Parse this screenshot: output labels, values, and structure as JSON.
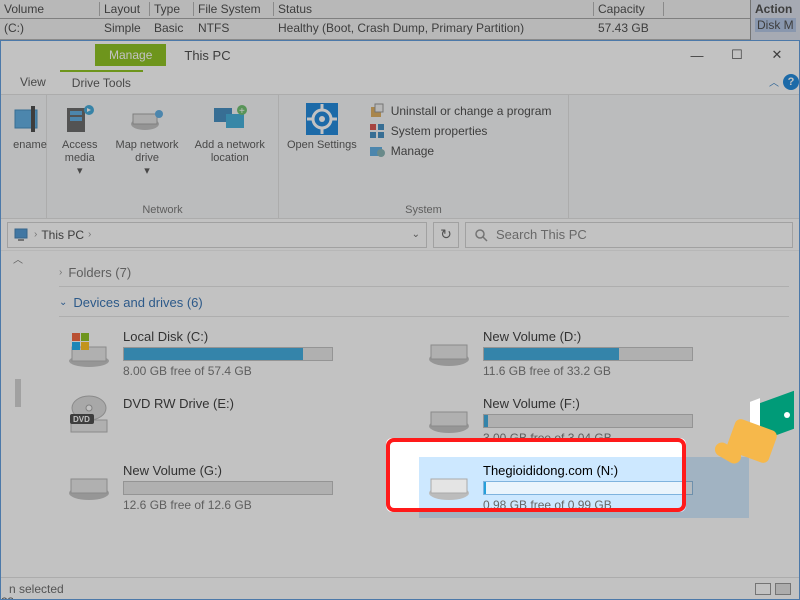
{
  "bg": {
    "headers": {
      "volume": "Volume",
      "layout": "Layout",
      "type": "Type",
      "fs": "File System",
      "status": "Status",
      "capacity": "Capacity"
    },
    "row": {
      "volume": "(C:)",
      "layout": "Simple",
      "type": "Basic",
      "fs": "NTFS",
      "status": "Healthy (Boot, Crash Dump, Primary Partition)",
      "capacity": "57.43 GB"
    },
    "side_title": "Action",
    "side_item": "Disk M"
  },
  "title": {
    "manage": "Manage",
    "text": "This PC"
  },
  "menu": {
    "view": "View",
    "drive_tools": "Drive Tools"
  },
  "ribbon": {
    "rename": "ename",
    "access_media": "Access media",
    "map_net": "Map network drive",
    "add_net": "Add a network location",
    "network_group": "Network",
    "open_settings": "Open Settings",
    "uninstall": "Uninstall or change a program",
    "sysprops": "System properties",
    "manage": "Manage",
    "system_group": "System"
  },
  "addr": {
    "crumb": "This PC",
    "refresh": "↻"
  },
  "search": {
    "placeholder": "Search This PC"
  },
  "sections": {
    "folders": "Folders (7)",
    "devices": "Devices and drives (6)"
  },
  "drives": [
    {
      "name": "Local Disk (C:)",
      "free": "8.00 GB free of 57.4 GB",
      "fill": 86,
      "icon": "win"
    },
    {
      "name": "New Volume (D:)",
      "free": "11.6 GB free of 33.2 GB",
      "fill": 65,
      "icon": "hdd"
    },
    {
      "name": "DVD RW Drive (E:)",
      "free": "",
      "fill": -1,
      "icon": "dvd"
    },
    {
      "name": "New Volume (F:)",
      "free": "3.00 GB free of 3.04 GB",
      "fill": 2,
      "icon": "hdd"
    },
    {
      "name": "New Volume (G:)",
      "free": "12.6 GB free of 12.6 GB",
      "fill": 0,
      "icon": "hdd"
    },
    {
      "name": "Thegioididong.com (N:)",
      "free": "0.98 GB free of 0.99 GB",
      "fill": 1,
      "icon": "hdd"
    }
  ],
  "left_rail": {
    "mes": "mes"
  },
  "status": {
    "selected": "n selected"
  }
}
